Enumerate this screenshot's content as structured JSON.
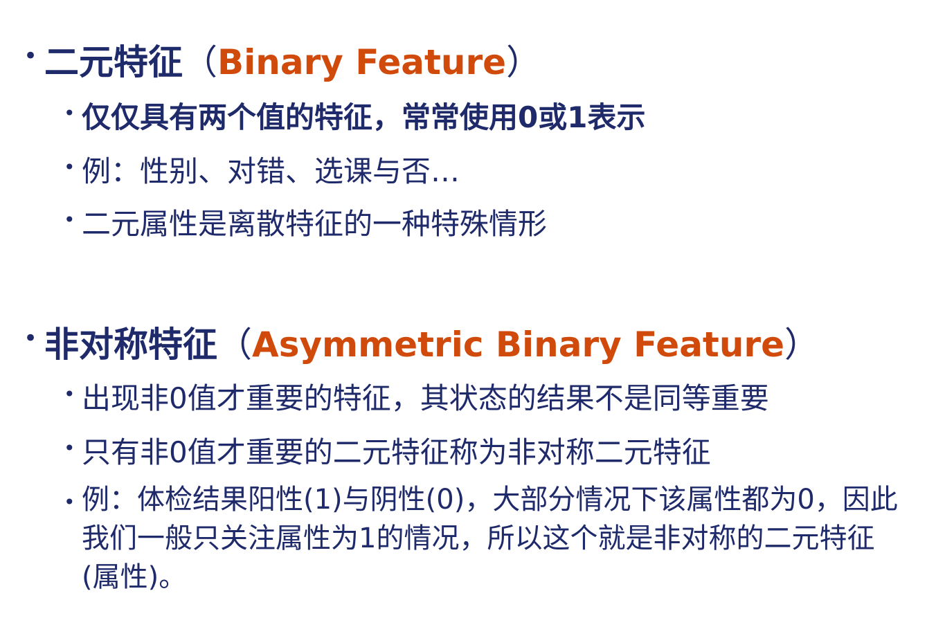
{
  "section1": {
    "title_cn": "二元特征",
    "paren_open": "（",
    "title_en": "Binary Feature",
    "paren_close": "）",
    "points": [
      "仅仅具有两个值的特征，常常使用0或1表示",
      "例：性别、对错、选课与否…",
      "二元属性是离散特征的一种特殊情形"
    ]
  },
  "section2": {
    "title_cn": "非对称特征",
    "paren_open": "（",
    "title_en": "Asymmetric Binary Feature",
    "paren_close": "）",
    "points": [
      "出现非0值才重要的特征，其状态的结果不是同等重要",
      "只有非0值才重要的二元特征称为非对称二元特征",
      "例：体检结果阳性(1)与阴性(0)，大部分情况下该属性都为0，因此我们一般只关注属性为1的情况，所以这个就是非对称的二元特征(属性)。"
    ]
  }
}
